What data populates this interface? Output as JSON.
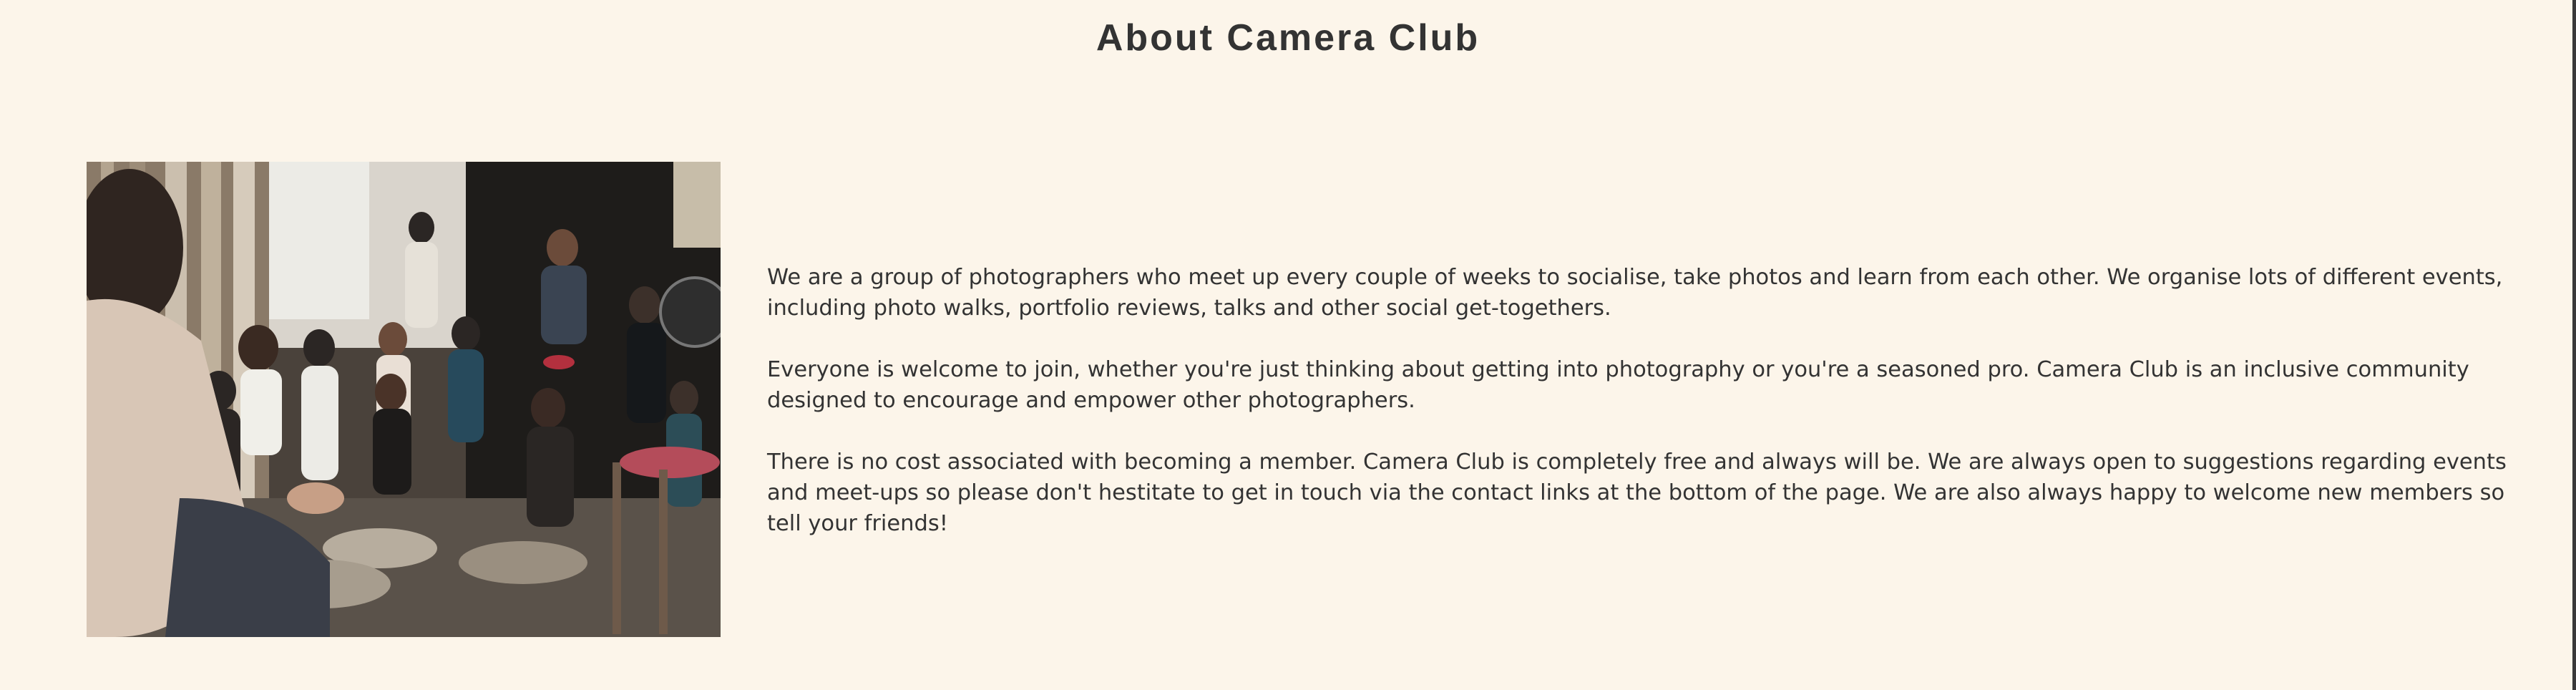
{
  "section": {
    "title": "About Camera Club",
    "paragraphs": [
      "We are a group of photographers who meet up every couple of weeks to socialise, take photos and learn from each other. We organise lots of different events, including photo walks, portfolio reviews, talks and other social get-togethers.",
      "Everyone is welcome to join, whether you're just thinking about getting into photography or you're a seasoned pro. Camera Club is an inclusive community designed to encourage and empower other photographers.",
      "There is no cost associated with becoming a member. Camera Club is completely free and always will be. We are always open to suggestions regarding events and meet-ups so please don't hestitate to get in touch via the contact links at the bottom of the page. We are also always happy to welcome new members so tell your friends!"
    ]
  },
  "colors": {
    "background": "#fcf5ea",
    "text": "#333333"
  }
}
